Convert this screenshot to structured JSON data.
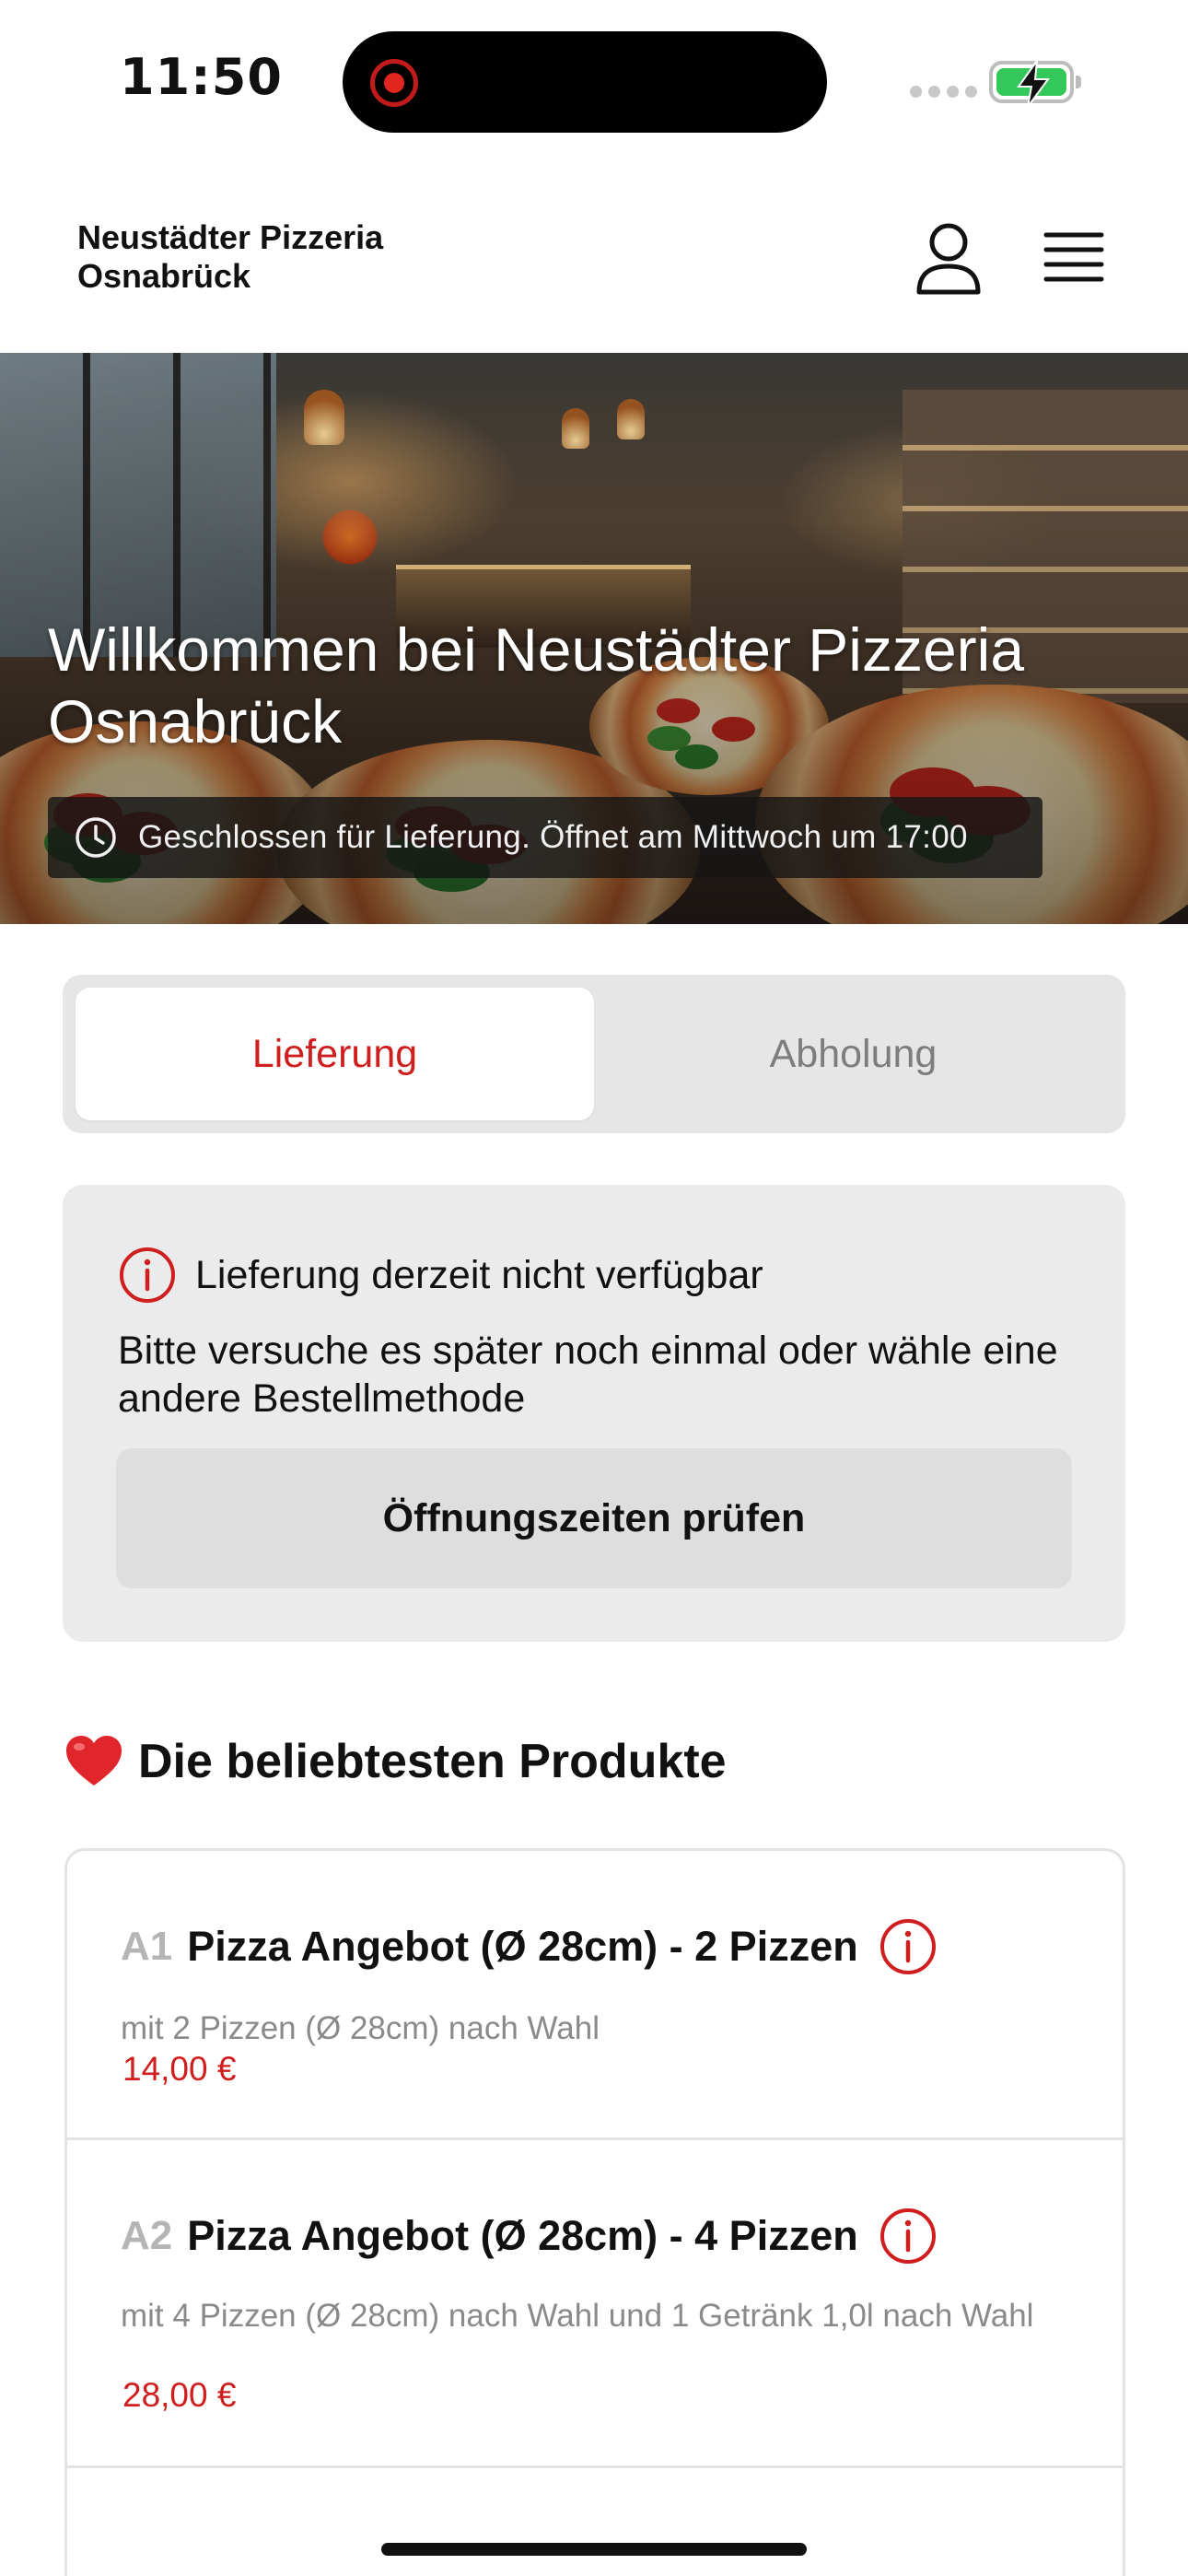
{
  "status_bar": {
    "time": "11:50"
  },
  "header": {
    "brand_line1": "Neustädter Pizzeria",
    "brand_line2": "Osnabrück",
    "profile_icon": "person-icon",
    "menu_icon": "hamburger-menu-icon"
  },
  "hero": {
    "title": "Willkommen bei Neustädter Pizzeria Osnabrück",
    "hours_text": "Geschlossen für Lieferung. Öffnet am Mittwoch um 17:00"
  },
  "tabs": [
    {
      "label": "Lieferung",
      "active": true
    },
    {
      "label": "Abholung",
      "active": false
    }
  ],
  "notice": {
    "title": "Lieferung derzeit nicht verfügbar",
    "text": "Bitte versuche es später noch einmal oder wähle eine andere Bestellmethode",
    "button": "Öffnungszeiten prüfen"
  },
  "popular": {
    "title": "Die beliebtesten Produkte",
    "products": [
      {
        "code": "A1",
        "name": "Pizza Angebot (Ø 28cm) - 2 Pizzen",
        "desc": "mit 2 Pizzen (Ø 28cm) nach Wahl",
        "price": "14,00 €"
      },
      {
        "code": "A2",
        "name": "Pizza Angebot (Ø 28cm) - 4 Pizzen",
        "desc": "mit 4 Pizzen (Ø 28cm) nach Wahl und 1 Getränk 1,0l nach Wahl",
        "price": "28,00 €"
      }
    ]
  },
  "colors": {
    "accent": "#d01e1e",
    "panel": "#ebebeb",
    "battery": "#34c759"
  }
}
